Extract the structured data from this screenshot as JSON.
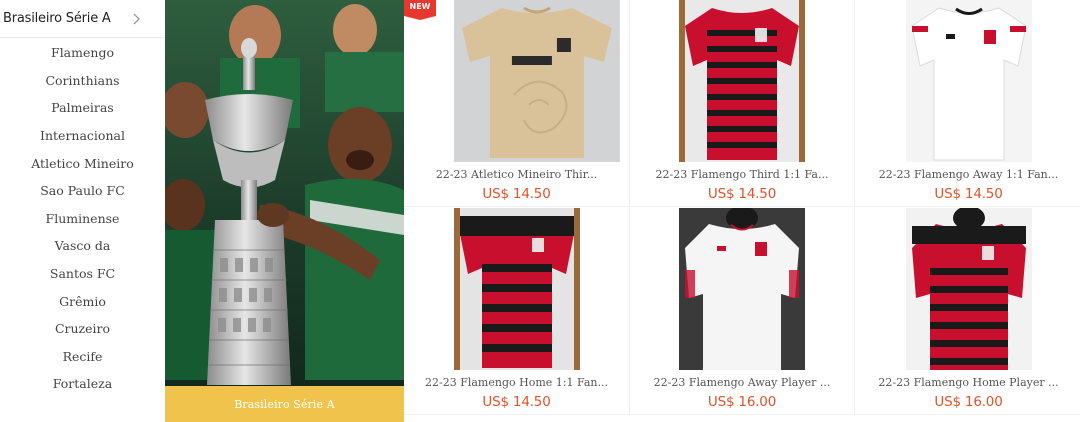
{
  "sidebar": {
    "title": "Brasileiro Série A",
    "items": [
      {
        "label": "Flamengo"
      },
      {
        "label": "Corinthians"
      },
      {
        "label": "Palmeiras"
      },
      {
        "label": "Internacional"
      },
      {
        "label": "Atletico Mineiro"
      },
      {
        "label": "Sao Paulo FC"
      },
      {
        "label": "Fluminense"
      },
      {
        "label": "Vasco da"
      },
      {
        "label": "Santos FC"
      },
      {
        "label": "Grêmio"
      },
      {
        "label": "Cruzeiro"
      },
      {
        "label": "Recife"
      },
      {
        "label": "Fortaleza"
      }
    ]
  },
  "banner": {
    "caption": "Brasileiro Série A"
  },
  "products": [
    {
      "name": "22-23 Atletico Mineiro Thir...",
      "price": "US$ 14.50",
      "badge": "NEW"
    },
    {
      "name": "22-23 Flamengo Third 1:1 Fa...",
      "price": "US$ 14.50"
    },
    {
      "name": "22-23 Flamengo Away 1:1 Fan...",
      "price": "US$ 14.50"
    },
    {
      "name": "22-23 Flamengo Home 1:1 Fan...",
      "price": "US$ 14.50"
    },
    {
      "name": "22-23 Flamengo Away Player ...",
      "price": "US$ 16.00"
    },
    {
      "name": "22-23 Flamengo Home Player ...",
      "price": "US$ 16.00"
    }
  ],
  "colors": {
    "accent": "#e0532a",
    "badge": "#e8372f",
    "caption_bg": "#f0c44c",
    "flamengo_red": "#c8102e",
    "flamengo_black": "#1a1a1a",
    "atletico_beige": "#d9c29a"
  }
}
